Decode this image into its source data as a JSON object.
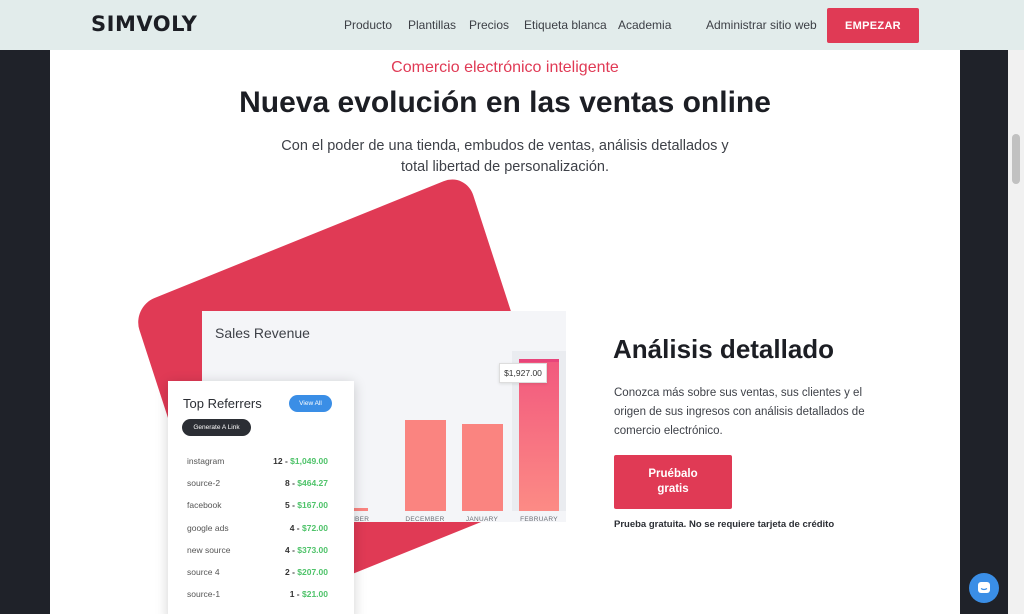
{
  "header": {
    "logo": "SIMVOLY",
    "nav": [
      "Producto",
      "Plantillas",
      "Precios",
      "Etiqueta blanca",
      "Academia"
    ],
    "admin_link": "Administrar sitio web",
    "cta": "EMPEZAR"
  },
  "hero": {
    "eyebrow": "Comercio electrónico inteligente",
    "title": "Nueva evolución en las ventas online",
    "subtitle": "Con el poder de una tienda, embudos de ventas, análisis detallados y total libertad de personalización."
  },
  "chart_data": {
    "type": "bar",
    "title": "Sales Revenue",
    "categories": [
      "NOVEMBER",
      "DECEMBER",
      "JANUARY",
      "FEBRUARY"
    ],
    "category_labels_visible": [
      "EMBER",
      "DECEMBER",
      "JANUARY",
      "FEBRUARY"
    ],
    "values": [
      40,
      1150,
      1100,
      1927
    ],
    "highlight_label": "$1,927.00",
    "colors": {
      "bar": "#fa8480",
      "highlight_top": "#f2597e",
      "highlight_bottom": "#fc8b85"
    }
  },
  "referrers": {
    "title": "Top Referrers",
    "view_all": "View All",
    "generate_link": "Generate A Link",
    "rows": [
      {
        "name": "instagram",
        "count": "12",
        "amount": "$1,049.00"
      },
      {
        "name": "source-2",
        "count": "8",
        "amount": "$464.27"
      },
      {
        "name": "facebook",
        "count": "5",
        "amount": "$167.00"
      },
      {
        "name": "google ads",
        "count": "4",
        "amount": "$72.00"
      },
      {
        "name": "new source",
        "count": "4",
        "amount": "$373.00"
      },
      {
        "name": "source 4",
        "count": "2",
        "amount": "$207.00"
      },
      {
        "name": "source-1",
        "count": "1",
        "amount": "$21.00"
      }
    ]
  },
  "feature": {
    "title": "Análisis detallado",
    "body": "Conozca más sobre sus ventas, sus clientes y el origen de sus ingresos con análisis detallados de comercio electrónico.",
    "cta": "Pruébalo gratis",
    "note": "Prueba gratuita. No se requiere tarjeta de crédito"
  },
  "chat": {
    "icon": "chat-icon"
  },
  "colors": {
    "accent": "#e03a55",
    "header_bg": "#e2eceb",
    "link_blue": "#3a8ee6",
    "money_green": "#4fc36a"
  }
}
